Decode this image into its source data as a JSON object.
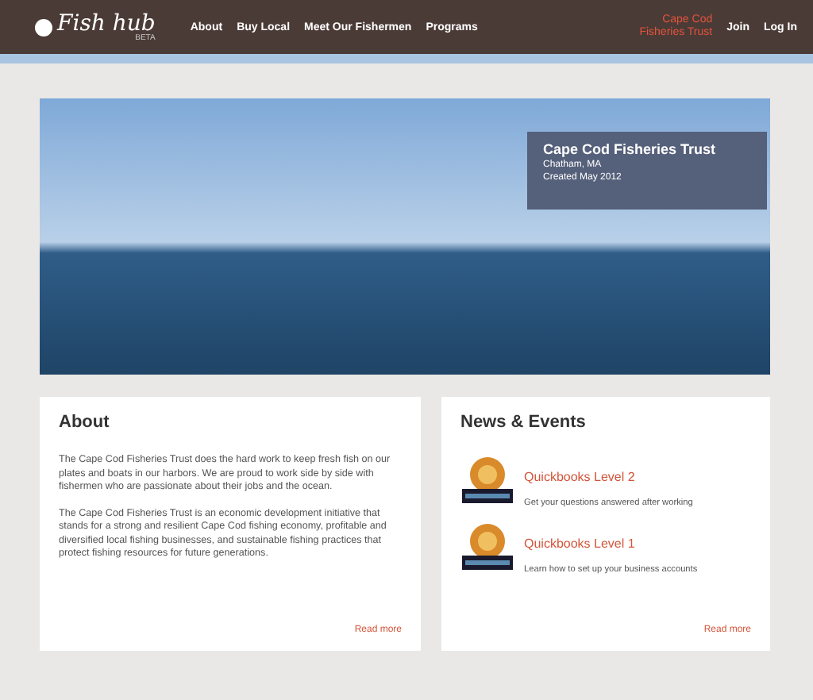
{
  "header": {
    "logo": "Fish hub",
    "badge": "BETA",
    "nav": [
      {
        "label": "About",
        "selected": false
      },
      {
        "label": "Buy Local",
        "selected": false
      },
      {
        "label": "Meet Our Fishermen",
        "selected": false
      },
      {
        "label": "Programs",
        "selected": false
      }
    ],
    "account": [
      {
        "label": "Cape Cod Fisheries Trust",
        "selected": true
      },
      {
        "label": "Join",
        "selected": false
      },
      {
        "label": "Log In",
        "selected": false
      }
    ]
  },
  "hero": {
    "title": "Cape Cod Fisheries Trust",
    "location": "Chatham, MA",
    "created": "Created May 2012"
  },
  "about": {
    "title": "About",
    "paragraphs": [
      "The Cape Cod Fisheries Trust does the hard work to keep fresh fish on our plates and boats in our harbors. We are proud to work side by side with fishermen who are passionate about their jobs and the ocean.",
      "The Cape Cod Fisheries Trust is an economic development initiative that stands for a strong and resilient Cape Cod fishing economy, profitable and diversified local fishing businesses, and sustainable fishing practices that protect fishing resources for future generations."
    ],
    "link": "Read more"
  },
  "news": {
    "title": "News & Events",
    "items": [
      {
        "title": "Quickbooks Level 2",
        "summary": "Get your questions answered after working"
      },
      {
        "title": "Quickbooks Level 1",
        "summary": "Learn how to set up your business accounts"
      }
    ],
    "link": "Read more"
  }
}
